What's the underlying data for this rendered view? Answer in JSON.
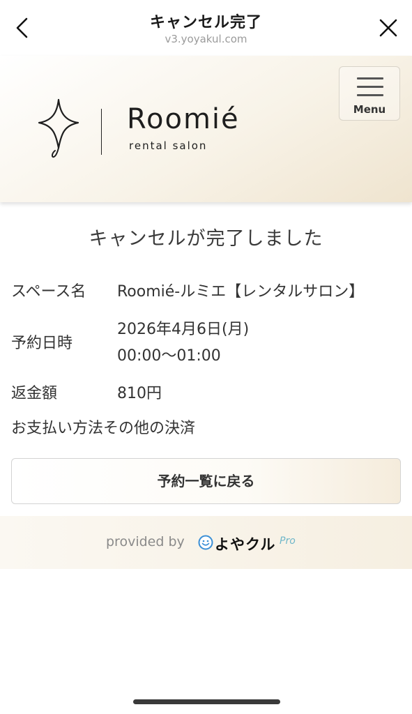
{
  "browser": {
    "title": "キャンセル完了",
    "url": "v3.yoyakul.com"
  },
  "header": {
    "brand_name": "Roomié",
    "brand_subtitle": "rental salon",
    "menu_label": "Menu"
  },
  "main": {
    "headline": "キャンセルが完了しました",
    "details": {
      "space_label": "スペース名",
      "space_value": "Roomié-ルミエ【レンタルサロン】",
      "date_label": "予約日時",
      "date_value": "2026年4月6日(月)",
      "time_value": "00:00〜01:00",
      "refund_label": "返金額",
      "refund_value": "810円",
      "payment_text": "お支払い方法その他の決済"
    },
    "back_button_label": "予約一覧に戻る"
  },
  "footer": {
    "provided_by": "provided by",
    "service_name": "よやクル",
    "service_tier": "Pro"
  },
  "icons": {
    "back": "chevron-left-icon",
    "close": "close-icon",
    "menu": "hamburger-icon",
    "logo_mark": "sparkle-star-icon",
    "yoyakul_mark": "smiley-face-icon"
  },
  "colors": {
    "header_gradient_end": "#efe4cf",
    "footer_bg": "#f6efe1",
    "pro_accent": "#6fb7c9"
  }
}
